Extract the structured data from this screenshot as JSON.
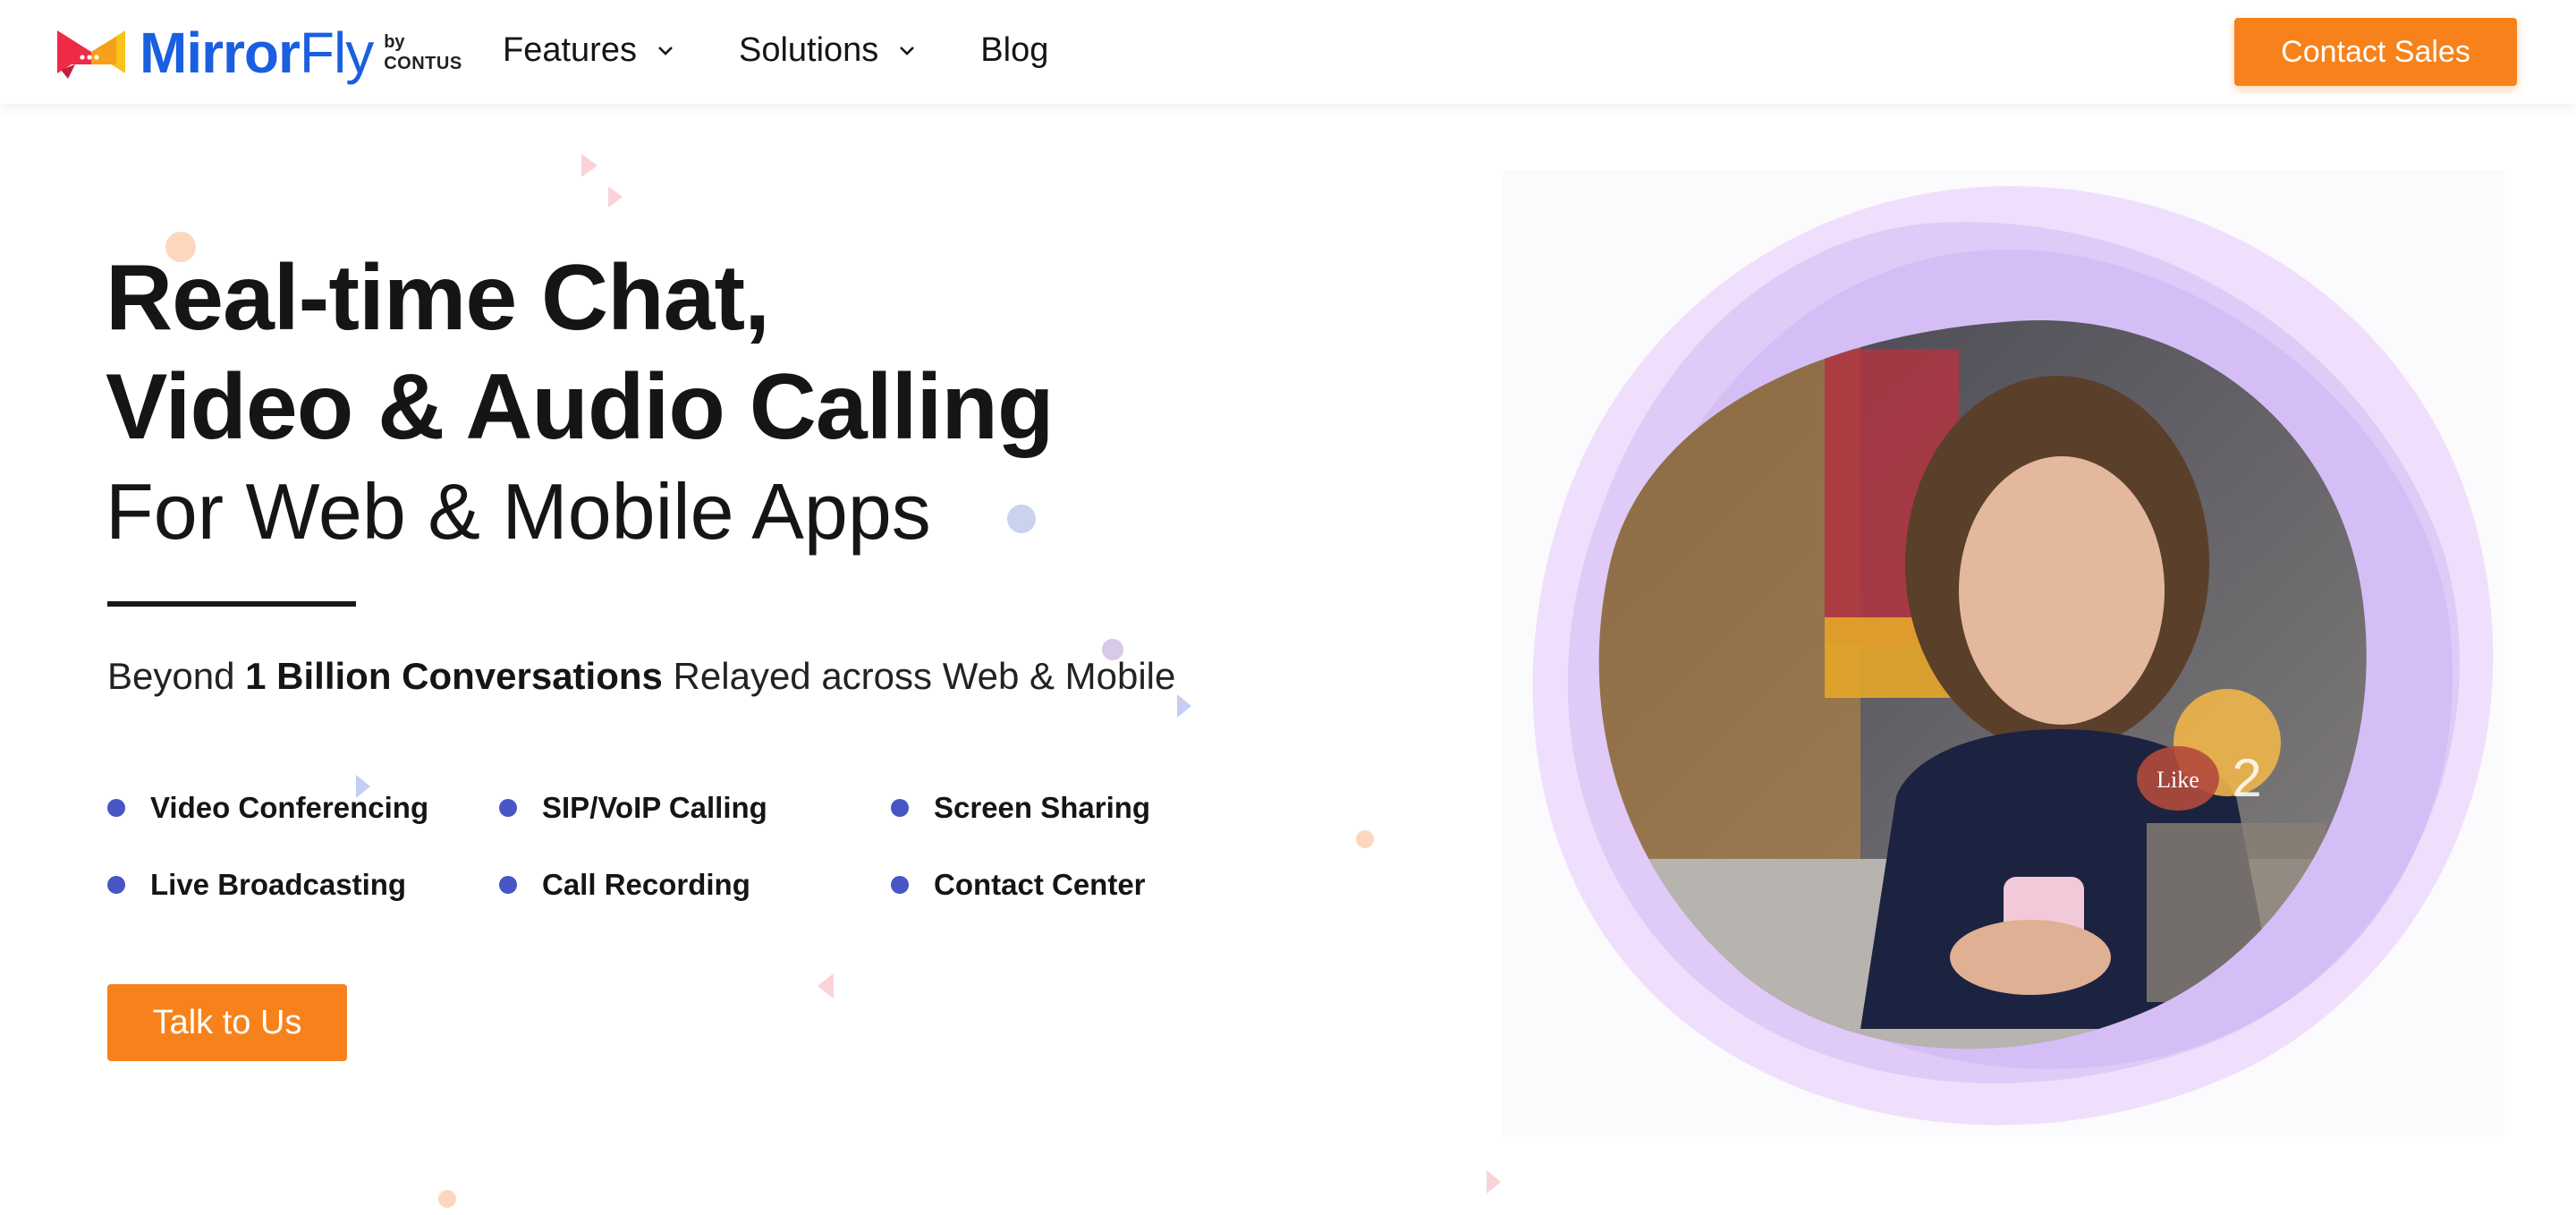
{
  "header": {
    "logo": {
      "brand_part1": "Mirror",
      "brand_part2": "Fly",
      "by": "by",
      "company": "CONTUS"
    },
    "nav": [
      {
        "label": "Features",
        "has_dropdown": true
      },
      {
        "label": "Solutions",
        "has_dropdown": true
      },
      {
        "label": "Blog",
        "has_dropdown": false
      }
    ],
    "cta_label": "Contact Sales"
  },
  "hero": {
    "title_line1": "Real-time Chat,",
    "title_line2": "Video & Audio Calling",
    "title_line3": "For Web & Mobile Apps",
    "tagline_prefix": "Beyond ",
    "tagline_bold": "1 Billion Conversations",
    "tagline_suffix": " Relayed across Web & Mobile",
    "features": [
      "Video Conferencing",
      "SIP/VoIP Calling",
      "Screen Sharing",
      "Live Broadcasting",
      "Call Recording",
      "Contact Center"
    ],
    "cta_label": "Talk to Us",
    "image_overlay": {
      "like_label": "Like",
      "like_count": "2"
    }
  },
  "colors": {
    "brand_blue": "#1a5fe0",
    "accent_orange": "#f7821b",
    "bullet": "#4656c4",
    "text": "#151515",
    "blob_purple": "#c9a4f2"
  },
  "icons": {
    "logo": "mirrorfly-logo-icon",
    "dropdown": "chevron-down-icon",
    "bullet": "bullet-dot-icon"
  }
}
